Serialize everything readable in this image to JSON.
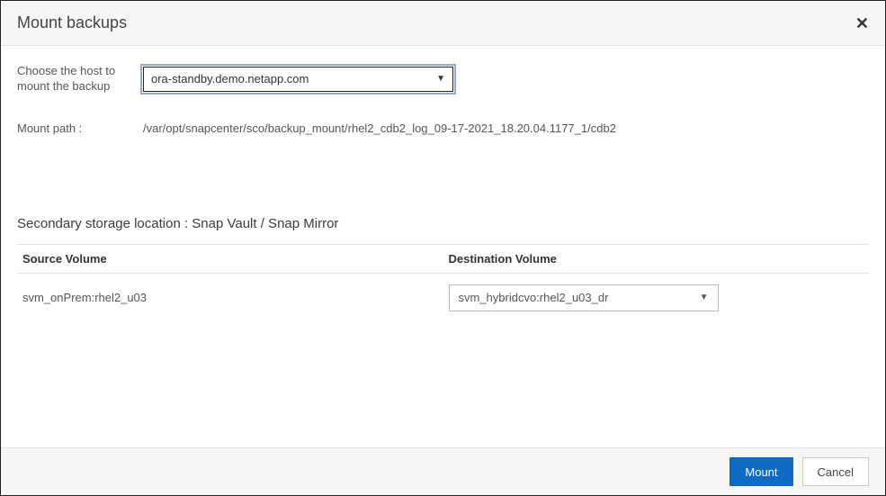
{
  "header": {
    "title": "Mount backups"
  },
  "host": {
    "label_line1": "Choose the host to",
    "label_line2": "mount the backup",
    "selected": "ora-standby.demo.netapp.com"
  },
  "mount_path": {
    "label": "Mount path :",
    "value": "/var/opt/snapcenter/sco/backup_mount/rhel2_cdb2_log_09-17-2021_18.20.04.1177_1/cdb2"
  },
  "secondary": {
    "heading": "Secondary storage location : Snap Vault / Snap Mirror",
    "columns": {
      "source": "Source Volume",
      "destination": "Destination Volume"
    },
    "rows": [
      {
        "source": "svm_onPrem:rhel2_u03",
        "destination_selected": "svm_hybridcvo:rhel2_u03_dr"
      }
    ]
  },
  "footer": {
    "mount": "Mount",
    "cancel": "Cancel"
  }
}
